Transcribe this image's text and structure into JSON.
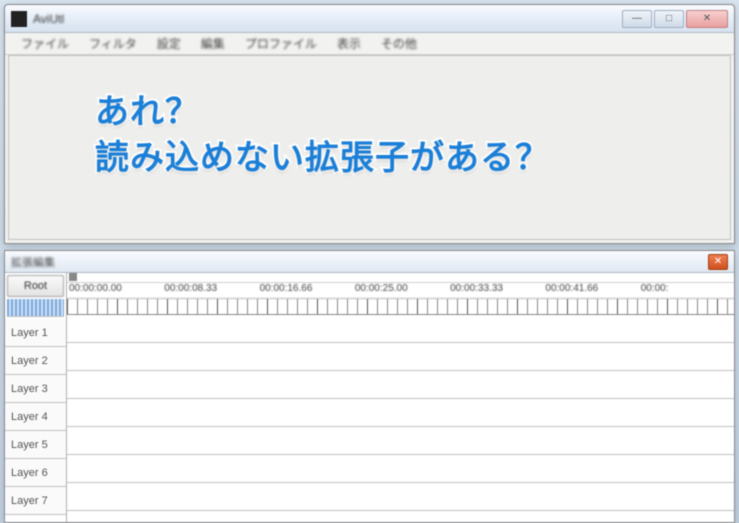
{
  "window": {
    "title": "AviUtl",
    "menu": [
      "ファイル",
      "フィルタ",
      "設定",
      "編集",
      "プロファイル",
      "表示",
      "その他"
    ]
  },
  "overlay": {
    "line1": "あれ？",
    "line2": "読み込めない拡張子がある？"
  },
  "timeline": {
    "title": "拡張編集",
    "root_label": "Root",
    "timecodes": [
      "00:00:00.00",
      "00:00:08.33",
      "00:00:16.66",
      "00:00:25.00",
      "00:00:33.33",
      "00:00:41.66",
      "00:00:"
    ],
    "layers": [
      "Layer 1",
      "Layer 2",
      "Layer 3",
      "Layer 4",
      "Layer 5",
      "Layer 6",
      "Layer 7"
    ]
  }
}
